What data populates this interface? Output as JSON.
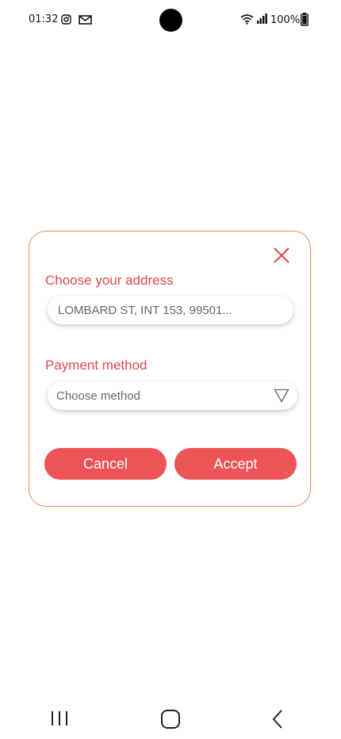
{
  "status_bar": {
    "time": "01:32",
    "battery_percent": "100%",
    "icons": [
      "instagram-icon",
      "mail-icon",
      "wifi-icon",
      "signal-icon",
      "battery-icon"
    ]
  },
  "dialog": {
    "close_icon": "close-icon",
    "address_label": "Choose your address",
    "address_value": "LOMBARD ST, INT 153, 99501...",
    "payment_label": "Payment method",
    "payment_placeholder": "Choose method",
    "dropdown_icon": "triangle-down-icon",
    "cancel_label": "Cancel",
    "accept_label": "Accept"
  },
  "colors": {
    "accent": "#ec5457",
    "label": "#e0484f",
    "dialog_border": "#e58a5a"
  },
  "nav_bar": {
    "items": [
      "recents-icon",
      "home-icon",
      "back-icon"
    ]
  }
}
